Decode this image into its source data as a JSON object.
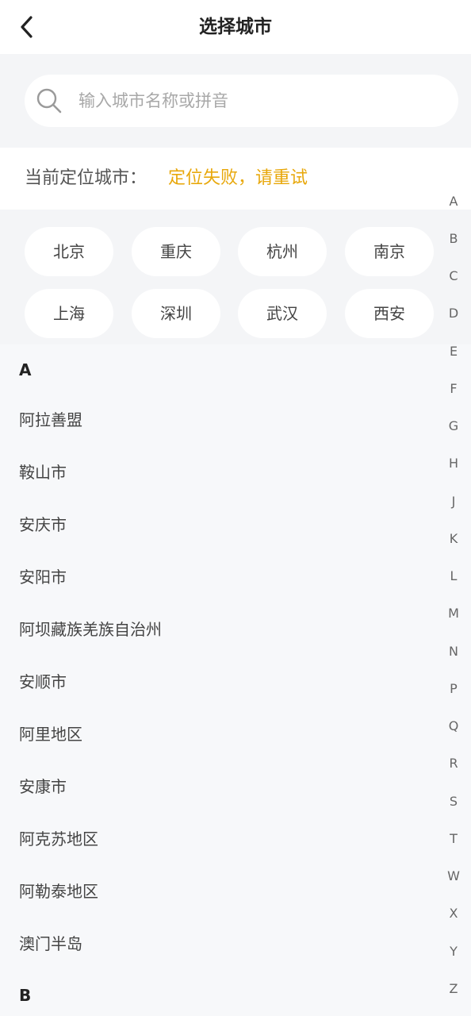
{
  "header": {
    "title": "选择城市",
    "back_icon": "chevron-left-icon"
  },
  "search": {
    "placeholder": "输入城市名称或拼音",
    "value": "",
    "icon": "search-icon"
  },
  "location": {
    "label": "当前定位城市：",
    "status": "定位失败，请重试",
    "status_color": "#e8a80c"
  },
  "hot_cities": [
    "北京",
    "重庆",
    "杭州",
    "南京",
    "上海",
    "深圳",
    "武汉",
    "西安"
  ],
  "sections": [
    {
      "letter": "A",
      "cities": [
        "阿拉善盟",
        "鞍山市",
        "安庆市",
        "安阳市",
        "阿坝藏族羌族自治州",
        "安顺市",
        "阿里地区",
        "安康市",
        "阿克苏地区",
        "阿勒泰地区",
        "澳门半岛"
      ]
    },
    {
      "letter": "B",
      "cities": []
    }
  ],
  "index_letters": [
    "A",
    "B",
    "C",
    "D",
    "E",
    "F",
    "G",
    "H",
    "J",
    "K",
    "L",
    "M",
    "N",
    "P",
    "Q",
    "R",
    "S",
    "T",
    "W",
    "X",
    "Y",
    "Z"
  ]
}
